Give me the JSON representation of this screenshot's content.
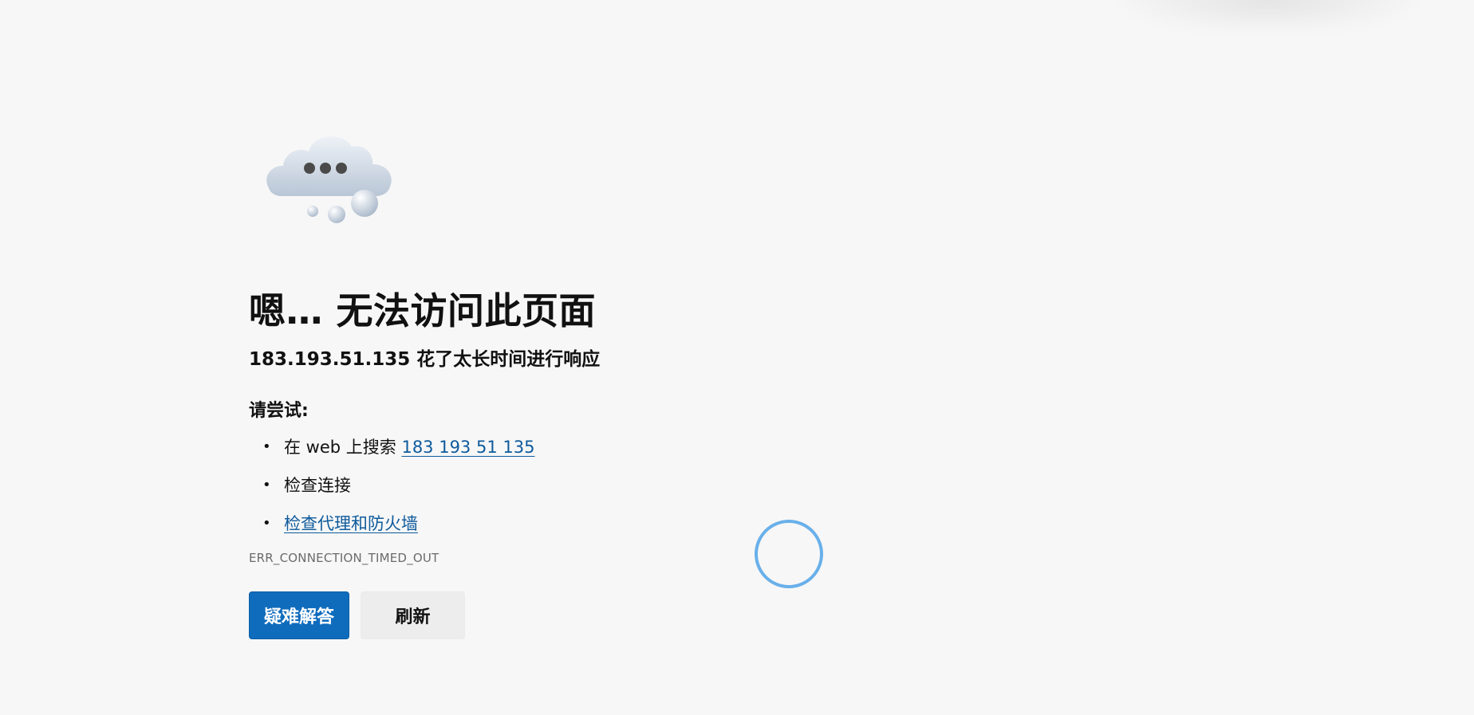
{
  "error_page": {
    "title": "嗯… 无法访问此页面",
    "subtitle": "183.193.51.135 花了太长时间进行响应",
    "try_heading": "请尝试:",
    "suggestions": [
      {
        "prefix": "在 web 上搜索 ",
        "link": "183 193 51 135"
      },
      {
        "text": "检查连接"
      },
      {
        "link": "检查代理和防火墙"
      }
    ],
    "bullet": "•",
    "error_code": "ERR_CONNECTION_TIMED_OUT",
    "buttons": {
      "troubleshoot": "疑难解答",
      "refresh": "刷新"
    },
    "icon": "cloud-dots-icon",
    "colors": {
      "background": "#f7f7f7",
      "primary": "#0f6cbd",
      "link": "#0e5a9c",
      "spinner": "#69b0ea"
    }
  }
}
